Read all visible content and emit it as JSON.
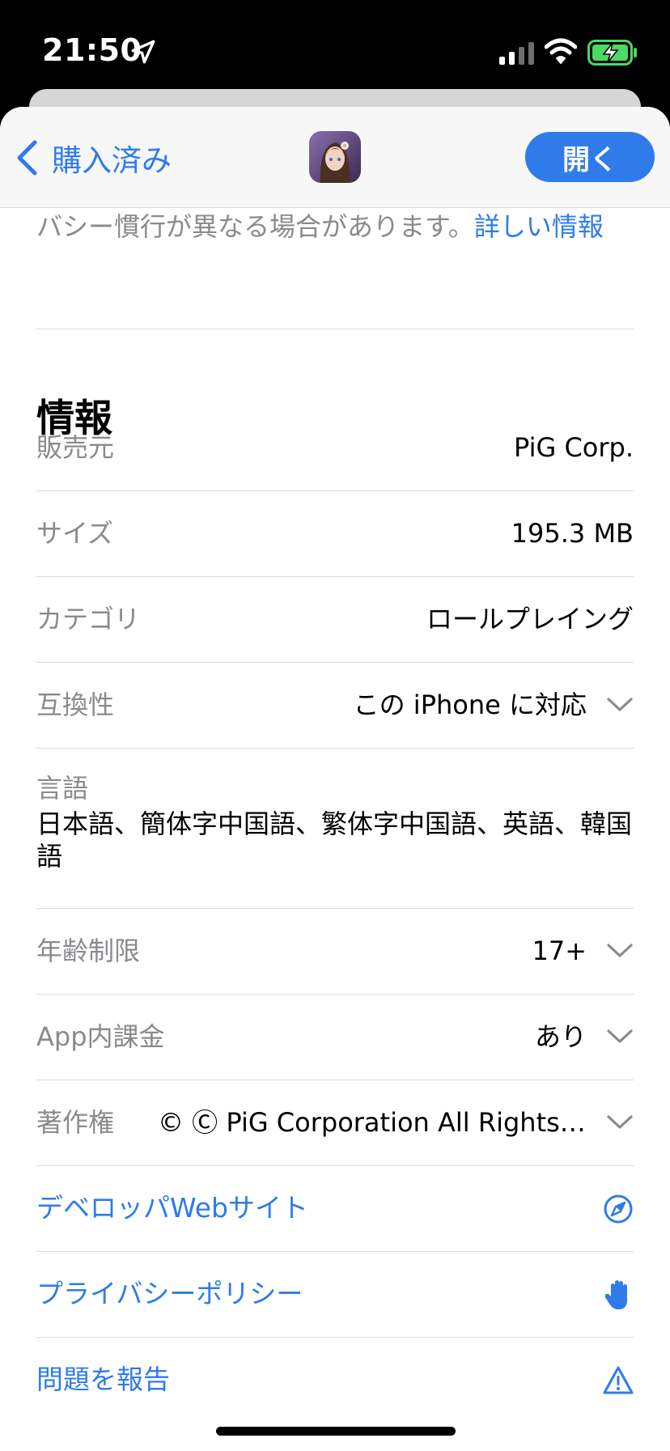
{
  "status_bar": {
    "time": "21:50"
  },
  "nav": {
    "back_label": "購入済み",
    "open_label": "開く"
  },
  "privacy": {
    "text": "バシー慣行が異なる場合があります。",
    "link": "詳しい情報"
  },
  "info": {
    "title": "情報",
    "rows": [
      {
        "label": "販売元",
        "value": "PiG Corp."
      },
      {
        "label": "サイズ",
        "value": "195.3 MB"
      },
      {
        "label": "カテゴリ",
        "value": "ロールプレイング"
      },
      {
        "label": "互換性",
        "value": "この iPhone に対応"
      }
    ],
    "languages": {
      "label": "言語",
      "value": "日本語、簡体字中国語、繁体字中国語、英語、韓国語"
    },
    "rows2": [
      {
        "label": "年齢制限",
        "value": "17+"
      },
      {
        "label": "App内課金",
        "value": "あり"
      },
      {
        "label": "著作権",
        "value": "© Ⓒ PiG Corporation All Rights R..."
      }
    ],
    "links": [
      {
        "label": "デベロッパWebサイト",
        "icon": "compass-icon"
      },
      {
        "label": "プライバシーポリシー",
        "icon": "hand-icon"
      },
      {
        "label": "問題を報告",
        "icon": "warning-icon"
      }
    ]
  },
  "colors": {
    "accent": "#2f7bea",
    "secondary_text": "#8a8a8e"
  }
}
